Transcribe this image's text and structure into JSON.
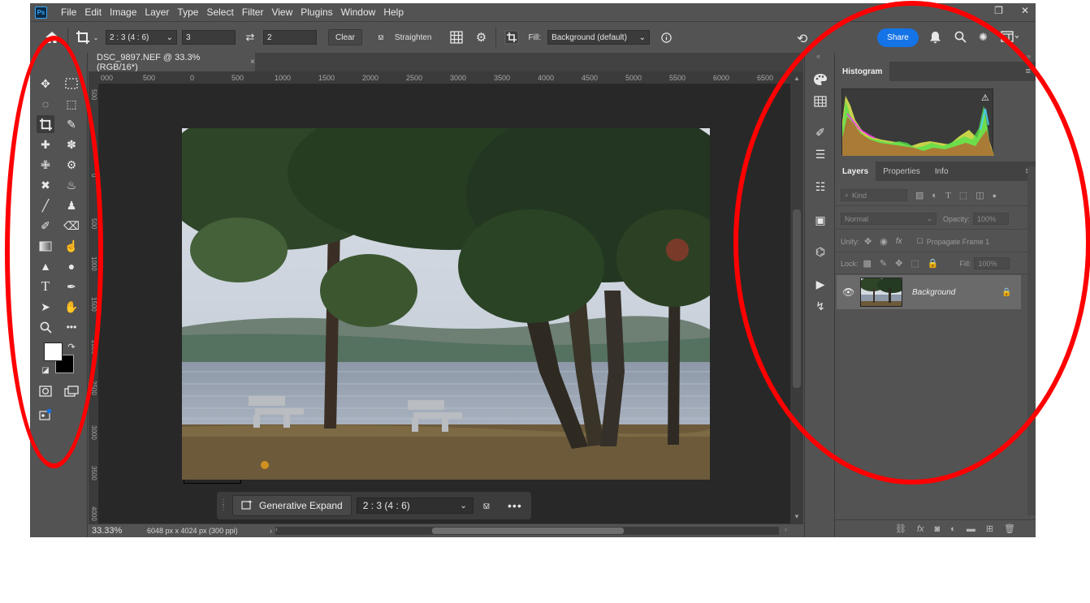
{
  "app_icon": "Ps",
  "menu": [
    "File",
    "Edit",
    "Image",
    "Layer",
    "Type",
    "Select",
    "Filter",
    "View",
    "Plugins",
    "Window",
    "Help"
  ],
  "window_controls": [
    "restore-icon",
    "close-icon"
  ],
  "options_bar": {
    "ratio_preset": "2 : 3 (4 : 6)",
    "width_value": "3",
    "height_value": "2",
    "clear_label": "Clear",
    "straighten_label": "Straighten",
    "fill_label": "Fill:",
    "fill_value": "Background (default)",
    "share_label": "Share"
  },
  "document": {
    "tab_title": "DSC_9897.NEF @ 33.3% (RGB/16*)",
    "tab_close": "×"
  },
  "ruler_top": [
    "000",
    "500",
    "0",
    "500",
    "1000",
    "1500",
    "2000",
    "2500",
    "3000",
    "3500",
    "4000",
    "4500",
    "5000",
    "5500",
    "6000",
    "6500"
  ],
  "ruler_left": [
    "500",
    "0",
    "500",
    "1000",
    "1500",
    "2000",
    "2500",
    "3000",
    "3500",
    "4000"
  ],
  "step_marker": "1",
  "task_bar": {
    "generative_expand_label": "Generative Expand",
    "ratio_value": "2 : 3 (4 : 6)",
    "more_label": "•••"
  },
  "status_bar": {
    "zoom": "33.33%",
    "doc_info": "6048 px x 4024 px (300 ppi)",
    "arrow": "›"
  },
  "histogram_panel": {
    "tabs": [
      "Histogram"
    ]
  },
  "layers_panel": {
    "tabs": [
      "Layers",
      "Properties",
      "Info"
    ],
    "kind_label": "Kind",
    "blend_mode": "Normal",
    "opacity_label": "Opacity:",
    "opacity_value": "100%",
    "unify_label": "Unify:",
    "propagate_label": "Propagate Frame 1",
    "lock_label": "Lock:",
    "fill_label": "Fill:",
    "fill_value": "100%",
    "layers": [
      {
        "name": "Background",
        "visible": true,
        "locked": true
      }
    ]
  },
  "colors": {
    "ui_background": "#535353",
    "canvas_background": "#282828",
    "accent_blue": "#1473e6",
    "annotation_red": "#ff0000"
  }
}
